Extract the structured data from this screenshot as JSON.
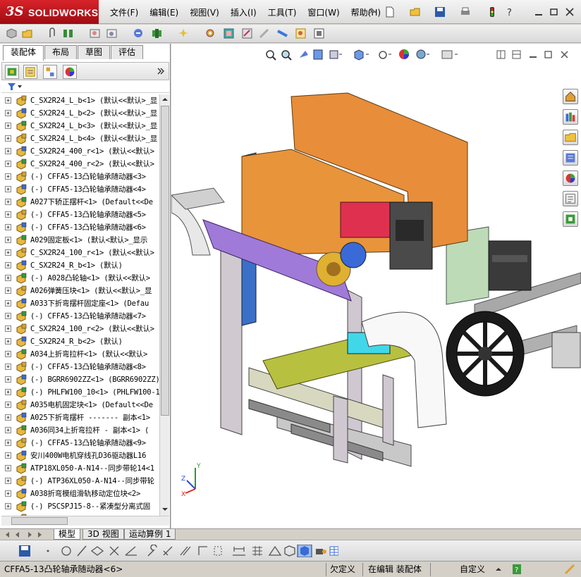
{
  "app": {
    "logo_ds": "3S",
    "logo_text": "SOLIDWORKS"
  },
  "menu": [
    "文件(F)",
    "编辑(E)",
    "视图(V)",
    "插入(I)",
    "工具(T)",
    "窗口(W)",
    "帮助(H)"
  ],
  "cm_tabs": [
    "装配体",
    "布局",
    "草图",
    "评估"
  ],
  "tree": {
    "items": [
      "C_SX2R24_L_b<1> (默认<<默认>_显",
      "C_SX2R24_L_b<2> (默认<<默认>_显",
      "C_SX2R24_L_b<3> (默认<<默认>_显",
      "C_SX2R24_L_b<4> (默认<<默认>_显",
      "C_SX2R24_400_r<1> (默认<<默认>",
      "C_SX2R24_400_r<2> (默认<<默认>",
      "(-) CFFA5-13凸轮轴承随动器<3>",
      "(-) CFFA5-13凸轮轴承随动器<4>",
      "A027下轿正摆杆<1> (Default<<De",
      "(-) CFFA5-13凸轮轴承随动器<5>",
      "(-) CFFA5-13凸轮轴承随动器<6>",
      "A029固定板<1> (默认<默认>_显示",
      "C_SX2R24_100_r<1> (默认<<默认>",
      "C_SX2R24_R_b<1> (默认)",
      "(-) A028凸轮轴<1> (默认<<默认>",
      "A026弹簧压块<1> (默认<<默认>_显",
      "A033下折弯摆杆固定座<1> (Defau",
      "(-) CFFA5-13凸轮轴承随动器<7>",
      "C_SX2R24_100_r<2> (默认<<默认>",
      "C_SX2R24_R_b<2> (默认)",
      "A034上折弯拉杆<1> (默认<<默认>",
      "(-) CFFA5-13凸轮轴承随动器<8>",
      "(-) BGRR6902ZZ<1> (BGRR6902ZZ)",
      "(-) PHLFW100_10<1> (PHLFW100-1",
      "A035电机固定块<1> (Default<<De",
      "A025下折弯摆杆 ------- 副本<1>",
      "A036同34上折弯拉杆 - 副本<1> (",
      "(-) CFFA5-13凸轮轴承随动器<9>",
      "安川400W电机穿线孔D36驱动器L16",
      "ATP18XL050-A-N14--同步带轮14<1",
      "(-) ATP36XL050-A-N14--同步带轮",
      "A038折弯模组滑轨移动定位块<2>",
      "(-) PSCSPJ15-8--紧凑型分离式固",
      "(-) ......"
    ]
  },
  "bottom_tabs": [
    "模型",
    "3D 视图",
    "运动算例 1"
  ],
  "status": {
    "selection": "CFFA5-13凸轮轴承随动器<6>",
    "defined": "欠定义",
    "editing": "在编辑 装配体",
    "units": "自定义"
  },
  "triad": {
    "x": "X",
    "y": "Y",
    "z": "Z"
  },
  "colors": {
    "brand": "#c4161c",
    "plate_orange": "#e8944a",
    "purple": "#a07ad8"
  }
}
